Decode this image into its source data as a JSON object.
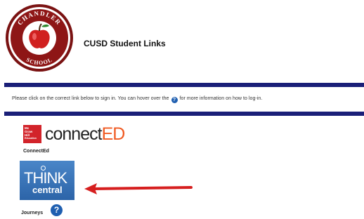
{
  "header": {
    "logo_text_top": "CHANDLER",
    "logo_text_side_left": "UNIFIED",
    "logo_text_bottom": "SCHOOL",
    "logo_text_side_right": "DISTRICT",
    "title": "CUSD Student Links"
  },
  "instructions": {
    "text_before": "Please click on the correct link below to sign in. You can hover over the",
    "help_glyph": "?",
    "text_after": "for more information on how to log-in."
  },
  "links": {
    "connected": {
      "badge_lines": [
        "Mc",
        "Graw",
        "Hill",
        "Education"
      ],
      "logo_main": "connect",
      "logo_accent": "ED",
      "label": "ConnectEd"
    },
    "thinkcentral": {
      "logo_top": "THINK",
      "logo_bottom": "central",
      "label": "Journeys",
      "help_glyph": "?"
    }
  },
  "colors": {
    "rule_blue": "#1a1f78",
    "help_blue": "#1f5fb0",
    "connect_accent": "#f05a22",
    "mh_red": "#d2232a",
    "think_blue": "#3a76bc",
    "arrow_red": "#d61f1f"
  },
  "icons": {
    "logo": "apple-seal-icon",
    "help": "question-circle-icon",
    "arrow": "red-arrow-left-icon"
  }
}
